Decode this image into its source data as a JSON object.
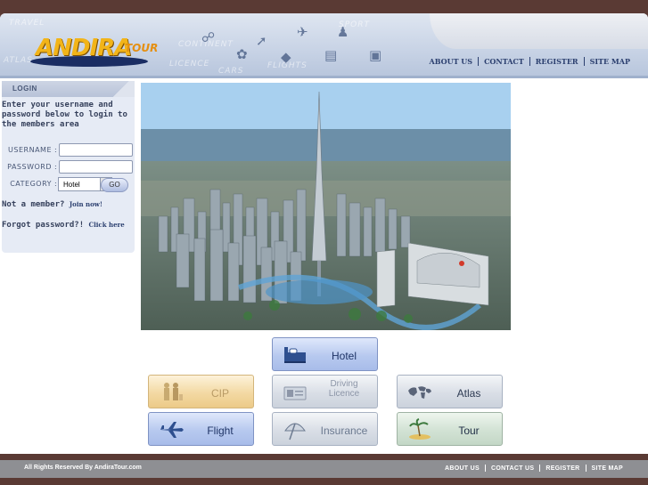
{
  "brand": {
    "name": "ANDIRA",
    "sub": "TOUR"
  },
  "header_watermarks": [
    "TRAVEL",
    "FLIGHTS",
    "CONTINENT",
    "LICENCE",
    "CARS",
    "ATLAS",
    "SPORT"
  ],
  "topnav": {
    "items": [
      "ABOUT US",
      "CONTACT",
      "REGISTER",
      "SITE MAP"
    ]
  },
  "login": {
    "title": "LOGIN",
    "intro": "Enter your username and password below to login to the members area",
    "username_label": "USERNAME",
    "password_label": "PASSWORD",
    "category_label": "CATEGORY",
    "category_value": "Hotel",
    "not_member_text": "Not a member?",
    "join_link": "Join now!",
    "forgot_text": "Forgot password?!",
    "forgot_link": "Click here",
    "go_label": "GO"
  },
  "services": {
    "hotel": "Hotel",
    "cip": "CIP",
    "driving": [
      "Driving",
      "Licence"
    ],
    "atlas": "Atlas",
    "flight": "Flight",
    "insurance": "Insurance",
    "tour": "Tour"
  },
  "footer": {
    "copyright": "All Rights Reserved By AndiraTour.com",
    "links": [
      "ABOUT US",
      "CONTACT US",
      "REGISTER",
      "SITE MAP"
    ]
  },
  "colors": {
    "background": "#5a3a34",
    "accent": "#1f3466",
    "logo": "#f2b419"
  }
}
